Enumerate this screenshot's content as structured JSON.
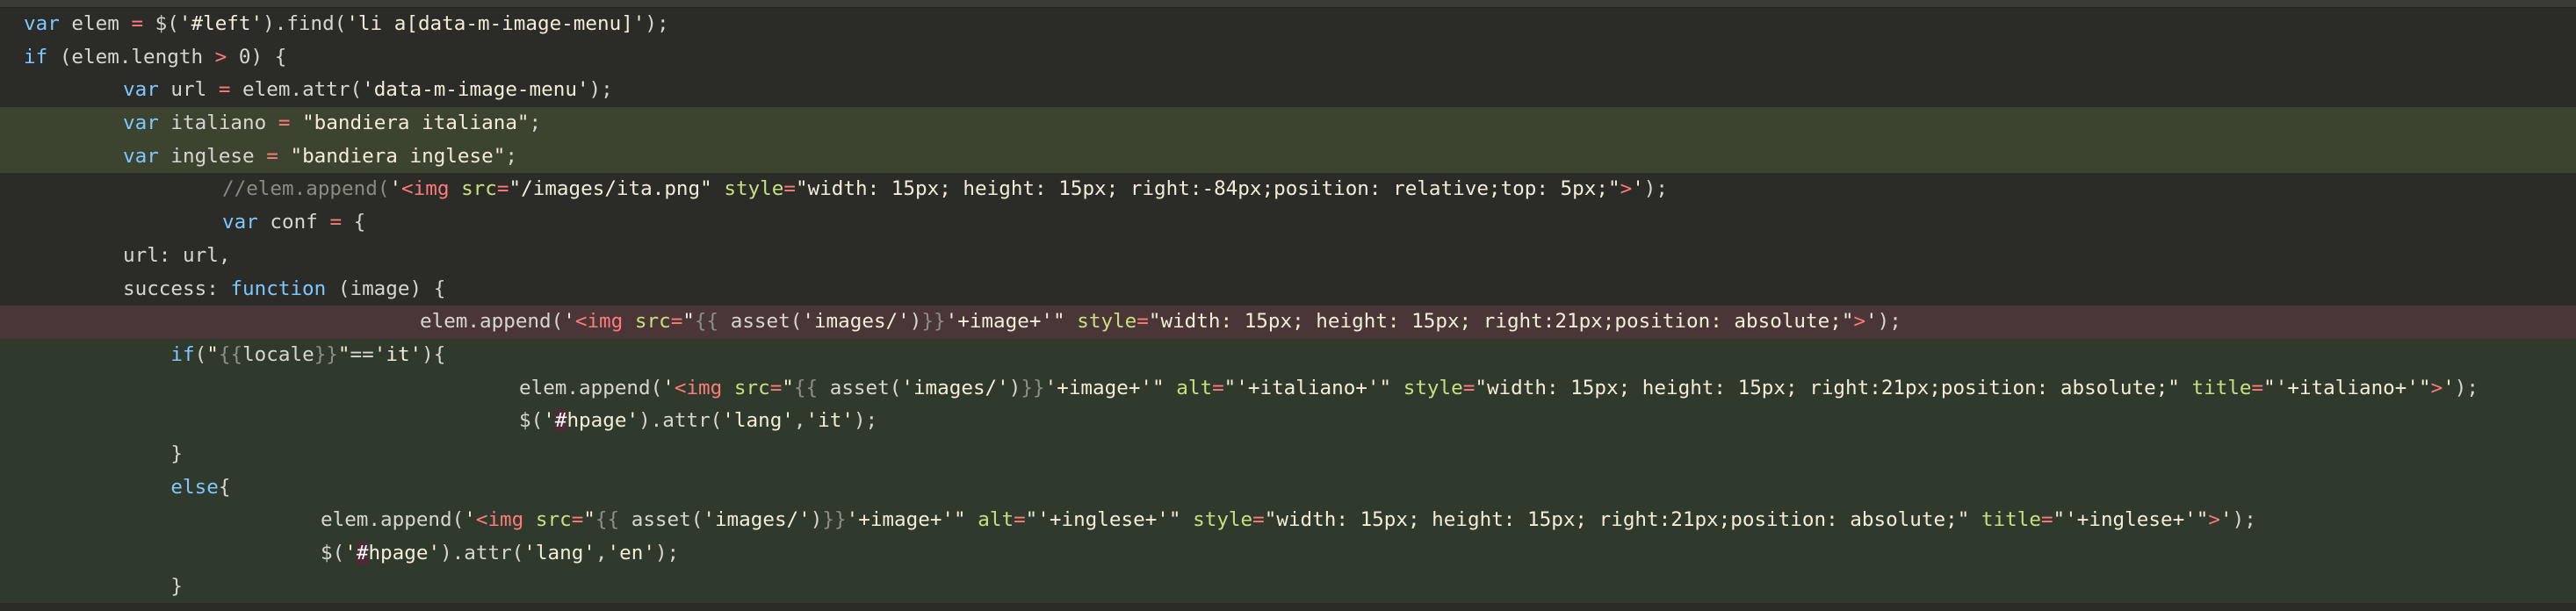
{
  "editor": {
    "lines": [
      {
        "t": "var elem = $('#left').find('li a[data-m-image-menu]');"
      },
      {
        "t": "if (elem.length > 0) {"
      },
      {
        "t": "var url = elem.attr('data-m-image-menu');"
      },
      {
        "t": "var italiano = \"bandiera italiana\";"
      },
      {
        "t": "var inglese = \"bandiera inglese\";"
      },
      {
        "t": "//elem.append('<img src=\"/images/ita.png\" style=\"width: 15px; height: 15px; right:-84px;position: relative;top: 5px;\">');"
      },
      {
        "t": "var conf = {"
      },
      {
        "t": "url: url,"
      },
      {
        "t": "success: function (image) {"
      },
      {
        "t": "elem.append('<img src=\"{{ asset('images/')}}'+image+'\" style=\"width: 15px; height: 15px; right:21px;position: absolute;\">');"
      },
      {
        "t": "if(\"{{locale}}\"=='it'){"
      },
      {
        "t": "elem.append('<img src=\"{{ asset('images/')}}'+image+'\" alt=\"'+italiano+'\" style=\"width: 15px; height: 15px; right:21px;position: absolute;\" title=\"'+italiano+'\">');"
      },
      {
        "t": "$('#hpage').attr('lang','it');"
      },
      {
        "t": "}"
      },
      {
        "t": "else{"
      },
      {
        "t": "elem.append('<img src=\"{{ asset('images/')}}'+image+'\" alt=\"'+inglese+'\" style=\"width: 15px; height: 15px; right:21px;position: absolute;\" title=\"'+inglese+'\">');"
      },
      {
        "t": "$('#hpage').attr('lang','en');"
      },
      {
        "t": "}"
      }
    ]
  },
  "colors": {
    "background": "#2b2c28",
    "green_highlight": "#3c4430",
    "red_highlight": "#4a3636",
    "keyword": "#7ec7ff",
    "attribute": "#c7e07f",
    "operator": "#ff7a7a",
    "comment": "#8a8a7f"
  }
}
